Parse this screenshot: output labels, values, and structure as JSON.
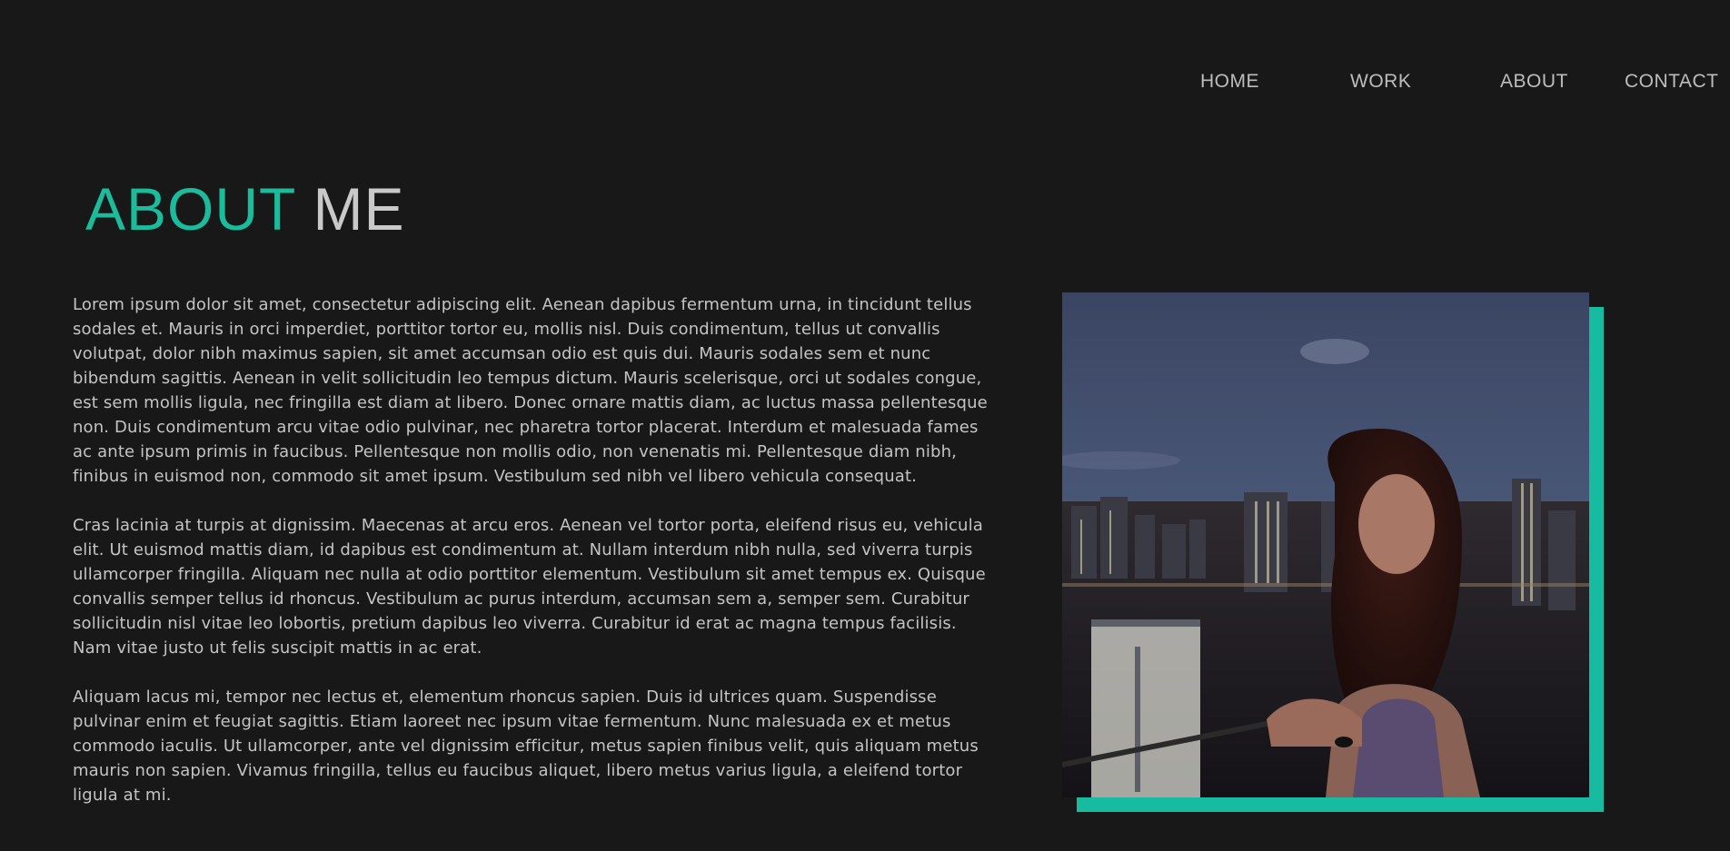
{
  "nav": {
    "items": [
      {
        "label": "HOME"
      },
      {
        "label": "WORK"
      },
      {
        "label": "ABOUT"
      },
      {
        "label": "CONTACT"
      }
    ]
  },
  "heading": {
    "accent": "ABOUT",
    "rest": "ME"
  },
  "bio": {
    "paragraphs": [
      "Lorem ipsum dolor sit amet, consectetur adipiscing elit. Aenean dapibus fermentum urna, in tincidunt tellus sodales et. Mauris in orci imperdiet, porttitor tortor eu, mollis nisl. Duis condimentum, tellus ut convallis volutpat, dolor nibh maximus sapien, sit amet accumsan odio est quis dui. Mauris sodales sem et nunc bibendum sagittis. Aenean in velit sollicitudin leo tempus dictum. Mauris scelerisque, orci ut sodales congue, est sem mollis ligula, nec fringilla est diam at libero. Donec ornare mattis diam, ac luctus massa pellentesque non. Duis condimentum arcu vitae odio pulvinar, nec pharetra tortor placerat. Interdum et malesuada fames ac ante ipsum primis in faucibus. Pellentesque non mollis odio, non venenatis mi. Pellentesque diam nibh, finibus in euismod non, commodo sit amet ipsum. Vestibulum sed nibh vel libero vehicula consequat.",
      "Cras lacinia at turpis at dignissim. Maecenas at arcu eros. Aenean vel tortor porta, eleifend risus eu, vehicula elit. Ut euismod mattis diam, id dapibus est condimentum at. Nullam interdum nibh nulla, sed viverra turpis ullamcorper fringilla. Aliquam nec nulla at odio porttitor elementum. Vestibulum sit amet tempus ex. Quisque convallis semper tellus id rhoncus. Vestibulum ac purus interdum, accumsan sem a, semper sem. Curabitur sollicitudin nisl vitae leo lobortis, pretium dapibus leo viverra. Curabitur id erat ac magna tempus facilisis. Nam vitae justo ut felis suscipit mattis in ac erat.",
      "Aliquam lacus mi, tempor nec lectus et, elementum rhoncus sapien. Duis id ultrices quam. Suspendisse pulvinar enim et feugiat sagittis. Etiam laoreet nec ipsum vitae fermentum. Nunc malesuada ex et metus commodo iaculis. Ut ullamcorper, ante vel dignissim efficitur, metus sapien finibus velit, quis aliquam metus mauris non sapien. Vivamus fringilla, tellus eu faucibus aliquet, libero metus varius ligula, a eleifend tortor ligula at mi."
    ]
  },
  "colors": {
    "background": "#181818",
    "accent": "#1abc9c",
    "text": "#c4c4c4",
    "nav_text": "#bdbdbd"
  }
}
